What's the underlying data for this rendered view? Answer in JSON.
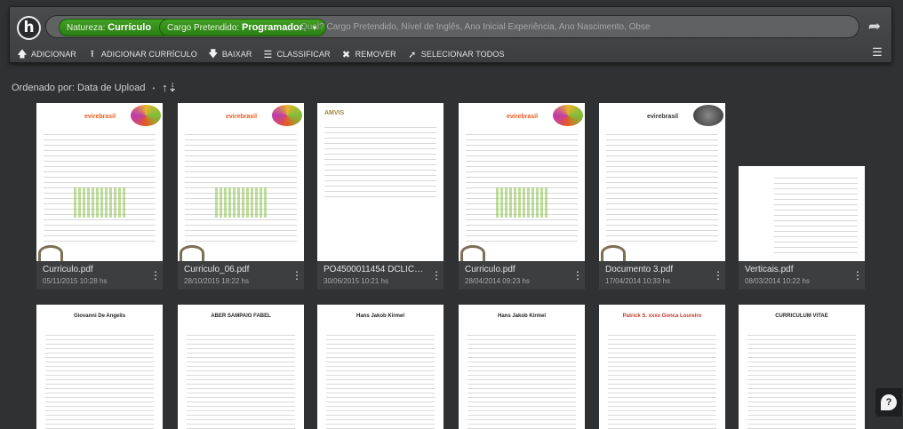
{
  "header": {
    "logo_letter": "h",
    "filters": [
      {
        "key": "Natureza:",
        "value": "Currículo"
      },
      {
        "key": "Cargo Pretendido:",
        "value": "Programador"
      }
    ],
    "search_placeholder": "Qual? Cargo Pretendido, Nível de Inglês, Ano Inicial Experiência, Ano Nascimento, Obse"
  },
  "toolbar": {
    "adicionar": "ADICIONAR",
    "adicionar_curriculo": "ADICIONAR CURRÍCULO",
    "baixar": "BAIXAR",
    "classificar": "CLASSIFICAR",
    "remover": "REMOVER",
    "selecionar_todos": "SELECIONAR TODOS"
  },
  "sort": {
    "label": "Ordenado por: Data de Upload",
    "separator": "•"
  },
  "files": [
    {
      "name": "Curriculo.pdf",
      "date": "05/11/2015 10:28 hs",
      "brand": "evirebrasil"
    },
    {
      "name": "Curriculo_06.pdf",
      "date": "28/10/2015 18:22 hs",
      "brand": "evirebrasil"
    },
    {
      "name": "PO4500011454 DCLICK -...",
      "date": "30/06/2015 10:21 hs",
      "brand": "AMVIS"
    },
    {
      "name": "Curriculo.pdf",
      "date": "28/04/2014 09:23 hs",
      "brand": "evirebrasil"
    },
    {
      "name": "Documento 3.pdf",
      "date": "17/04/2014 10:33 hs",
      "brand": "evirebrasil"
    },
    {
      "name": "Verticais.pdf",
      "date": "08/03/2014 10:22 hs",
      "brand": ""
    }
  ],
  "second_row": [
    {
      "title": "Giovanni De Angelis"
    },
    {
      "title": "ABER SAMPAIO FABEL"
    },
    {
      "title": "Hans Jakob Kirmel"
    },
    {
      "title": "Hans Jakob Kirmel"
    },
    {
      "title": "Patrick S. xxxx Gonca Loureiro"
    },
    {
      "title": "CURRICULUM VITAE"
    }
  ],
  "colors": {
    "accent_green": "#3a9420",
    "background": "#303132",
    "panel": "#3d3e40"
  },
  "icons": {
    "help": "?",
    "kebab": "⋮",
    "share": "➦",
    "list_view": "☰"
  }
}
